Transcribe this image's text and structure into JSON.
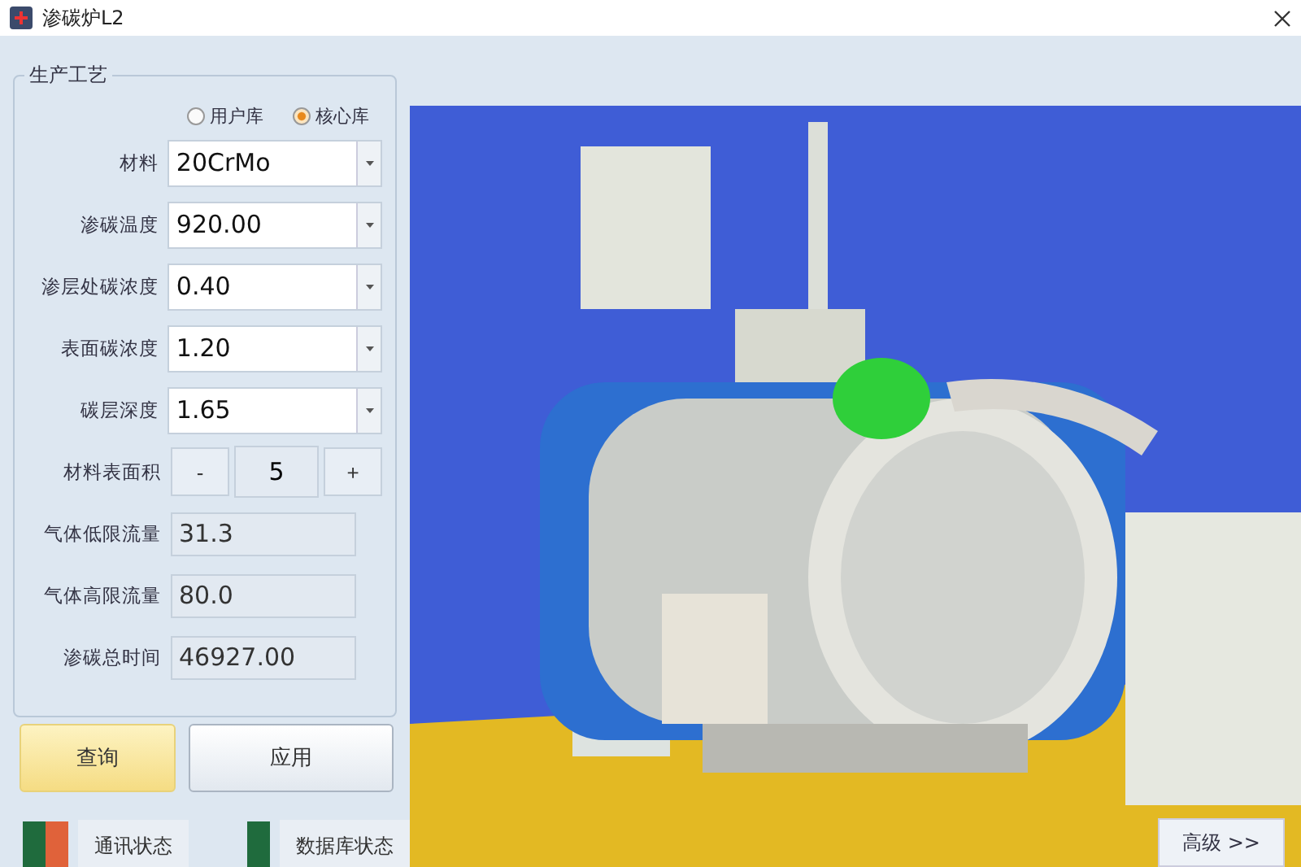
{
  "window": {
    "title": "渗碳炉L2"
  },
  "group": {
    "title": "生产工艺"
  },
  "library_options": [
    {
      "label": "用户库",
      "selected": false
    },
    {
      "label": "核心库",
      "selected": true
    }
  ],
  "fields": [
    {
      "kind": "dropdown",
      "label": "材料",
      "value": "20CrMo"
    },
    {
      "kind": "dropdown",
      "label": "渗碳温度",
      "value": "920.00"
    },
    {
      "kind": "dropdown",
      "label": "渗层处碳浓度",
      "value": "0.40"
    },
    {
      "kind": "dropdown",
      "label": "表面碳浓度",
      "value": "1.20"
    },
    {
      "kind": "dropdown",
      "label": "碳层深度",
      "value": "1.65"
    },
    {
      "kind": "stepper",
      "label": "材料表面积",
      "value": "5",
      "minus": "-",
      "plus": "+"
    },
    {
      "kind": "readonly",
      "label": "气体低限流量",
      "value": "31.3"
    },
    {
      "kind": "readonly",
      "label": "气体高限流量",
      "value": "80.0"
    },
    {
      "kind": "readonly",
      "label": "渗碳总时间",
      "value": "46927.00"
    }
  ],
  "actions": [
    {
      "label": "查询",
      "selected": true
    },
    {
      "label": "应用",
      "selected": false
    }
  ],
  "status": [
    {
      "label": "通讯状态",
      "lights": [
        {
          "color": "#1f6b3d"
        },
        {
          "color": "#e0623a"
        }
      ]
    },
    {
      "label": "数据库状态",
      "lights": [
        {
          "color": "#1f6b3d"
        }
      ]
    }
  ],
  "advanced_button": {
    "label": "高级 >>"
  }
}
